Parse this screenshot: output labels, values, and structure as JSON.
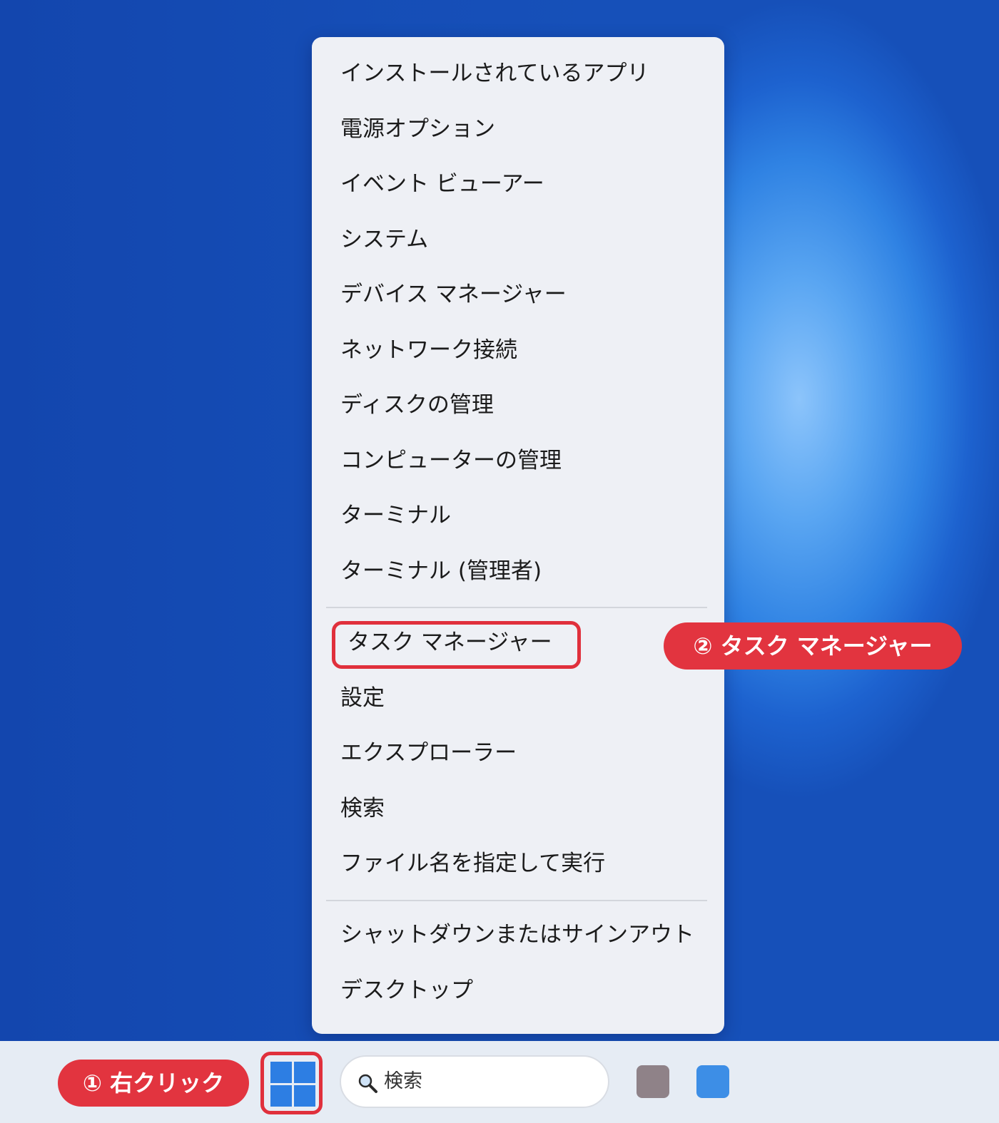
{
  "menu": {
    "group1": [
      "インストールされているアプリ",
      "電源オプション",
      "イベント ビューアー",
      "システム",
      "デバイス マネージャー",
      "ネットワーク接続",
      "ディスクの管理",
      "コンピューターの管理",
      "ターミナル",
      "ターミナル (管理者)"
    ],
    "group2": [
      "タスク マネージャー",
      "設定",
      "エクスプローラー",
      "検索",
      "ファイル名を指定して実行"
    ],
    "group3": [
      "シャットダウンまたはサインアウト",
      "デスクトップ"
    ]
  },
  "annotations": {
    "step1": "① 右クリック",
    "step2": "② タスク マネージャー",
    "highlight_color": "#e0303c"
  },
  "taskbar": {
    "search_label": "検索",
    "apps": [
      {
        "icon": "app-icon-gray",
        "color": "#8f8288"
      },
      {
        "icon": "app-icon-blue",
        "color": "#3d8ee6"
      }
    ]
  },
  "colors": {
    "accent": "#2d7ee3",
    "menu_background": "#eef0f5",
    "callout": "#e2343f"
  }
}
